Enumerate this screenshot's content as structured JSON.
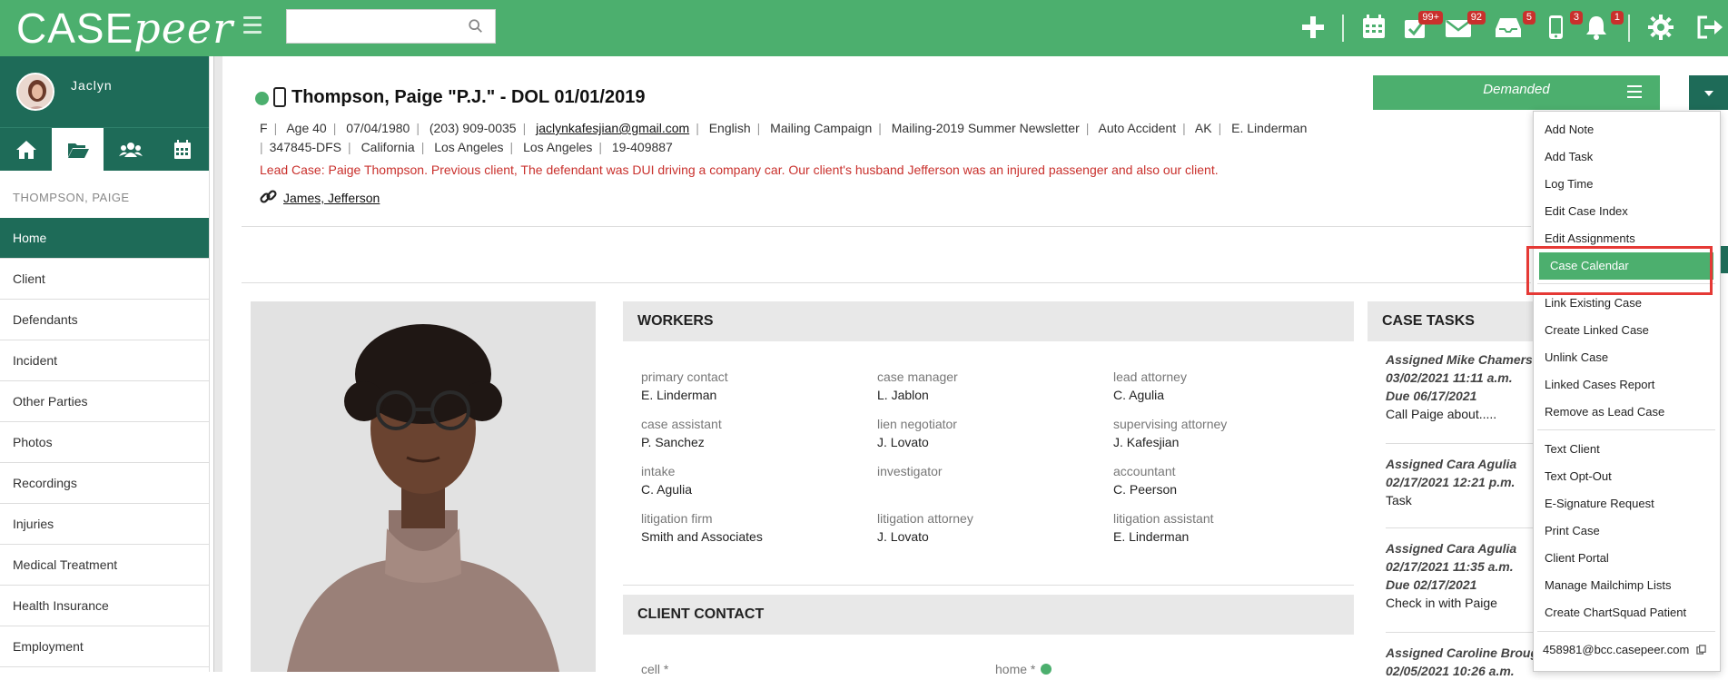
{
  "app": {
    "logo_case": "CASE",
    "logo_peer": "peer"
  },
  "search": {
    "placeholder": ""
  },
  "top_icons": [
    {
      "name": "plus-icon"
    },
    {
      "name": "calendar-icon"
    },
    {
      "name": "tasks-check-icon",
      "badge": "99+"
    },
    {
      "name": "mail-icon",
      "badge": "92"
    },
    {
      "name": "inbox-tray-icon",
      "badge": "5"
    },
    {
      "name": "phone-icon",
      "badge": "3"
    },
    {
      "name": "bell-icon",
      "badge": "1"
    },
    {
      "name": "gear-icon"
    },
    {
      "name": "sign-out-icon"
    }
  ],
  "user": {
    "name": "Jaclyn"
  },
  "sidebar": {
    "case_name": "THOMPSON, PAIGE",
    "items": [
      "Home",
      "Client",
      "Defendants",
      "Incident",
      "Other Parties",
      "Photos",
      "Recordings",
      "Injuries",
      "Medical Treatment",
      "Health Insurance",
      "Employment"
    ],
    "active": "Home"
  },
  "header": {
    "title": "Thompson, Paige \"P.J.\" - DOL 01/01/2019",
    "meta_line1": [
      "F",
      "Age 40",
      "07/04/1980",
      "(203) 909-0035",
      "jaclynkafesjian@gmail.com",
      "English",
      "Mailing Campaign",
      "Mailing-2019 Summer Newsletter",
      "Auto Accident",
      "AK",
      "E. Linderman"
    ],
    "meta_line2": [
      "347845-DFS",
      "California",
      "Los Angeles",
      "Los Angeles",
      "19-409887"
    ],
    "lead_case": "Lead Case: Paige Thompson. Previous client, The defendant was DUI driving a company car. Our client's husband Jefferson was an injured passenger and also our client.",
    "linked_case": "James, Jefferson",
    "status": "Demanded"
  },
  "workers": {
    "title": "WORKERS",
    "rows": [
      [
        {
          "label": "primary contact",
          "value": "E. Linderman"
        },
        {
          "label": "case manager",
          "value": "L. Jablon"
        },
        {
          "label": "lead attorney",
          "value": "C. Agulia"
        }
      ],
      [
        {
          "label": "case assistant",
          "value": "P. Sanchez"
        },
        {
          "label": "lien negotiator",
          "value": "J. Lovato"
        },
        {
          "label": "supervising attorney",
          "value": "J. Kafesjian"
        }
      ],
      [
        {
          "label": "intake",
          "value": "C. Agulia"
        },
        {
          "label": "investigator",
          "value": ""
        },
        {
          "label": "accountant",
          "value": "C. Peerson"
        }
      ],
      [
        {
          "label": "litigation firm",
          "value": "Smith and Associates"
        },
        {
          "label": "litigation attorney",
          "value": "J. Lovato"
        },
        {
          "label": "litigation assistant",
          "value": "E. Linderman"
        }
      ]
    ]
  },
  "client_contact": {
    "title": "CLIENT CONTACT",
    "cell_label": "cell *",
    "home_label": "home *"
  },
  "case_tasks": {
    "title": "CASE TASKS",
    "items": [
      {
        "l1": "Assigned Mike Chamers",
        "l2": "03/02/2021 11:11 a.m.",
        "l3": "Due 06/17/2021",
        "desc": "Call Paige about....."
      },
      {
        "l1": "Assigned Cara Agulia",
        "l2": "02/17/2021 12:21 p.m.",
        "l3": "",
        "desc": "Task"
      },
      {
        "l1": "Assigned Cara Agulia",
        "l2": "02/17/2021 11:35 a.m.",
        "l3": "Due 02/17/2021",
        "desc": "Check in with Paige"
      },
      {
        "l1": "Assigned Caroline Broug",
        "l2": "02/05/2021 10:26 a.m.",
        "l3": "",
        "desc": ""
      }
    ]
  },
  "dropdown": {
    "group1": [
      "Add Note",
      "Add Task",
      "Log Time",
      "Edit Case Index",
      "Edit Assignments",
      "Case Calendar"
    ],
    "group2": [
      "Link Existing Case",
      "Create Linked Case",
      "Unlink Case",
      "Linked Cases Report",
      "Remove as Lead Case"
    ],
    "group3": [
      "Text Client",
      "Text Opt-Out",
      "E-Signature Request",
      "Print Case",
      "Client Portal",
      "Manage Mailchimp Lists",
      "Create ChartSquad Patient"
    ],
    "email": "458981@bcc.casepeer.com",
    "highlighted": "Case Calendar"
  },
  "colors": {
    "brand_green": "#4caf6e",
    "dark_teal": "#1e6b58",
    "alert_red": "#c9302c",
    "highlight_box": "#e53935"
  }
}
